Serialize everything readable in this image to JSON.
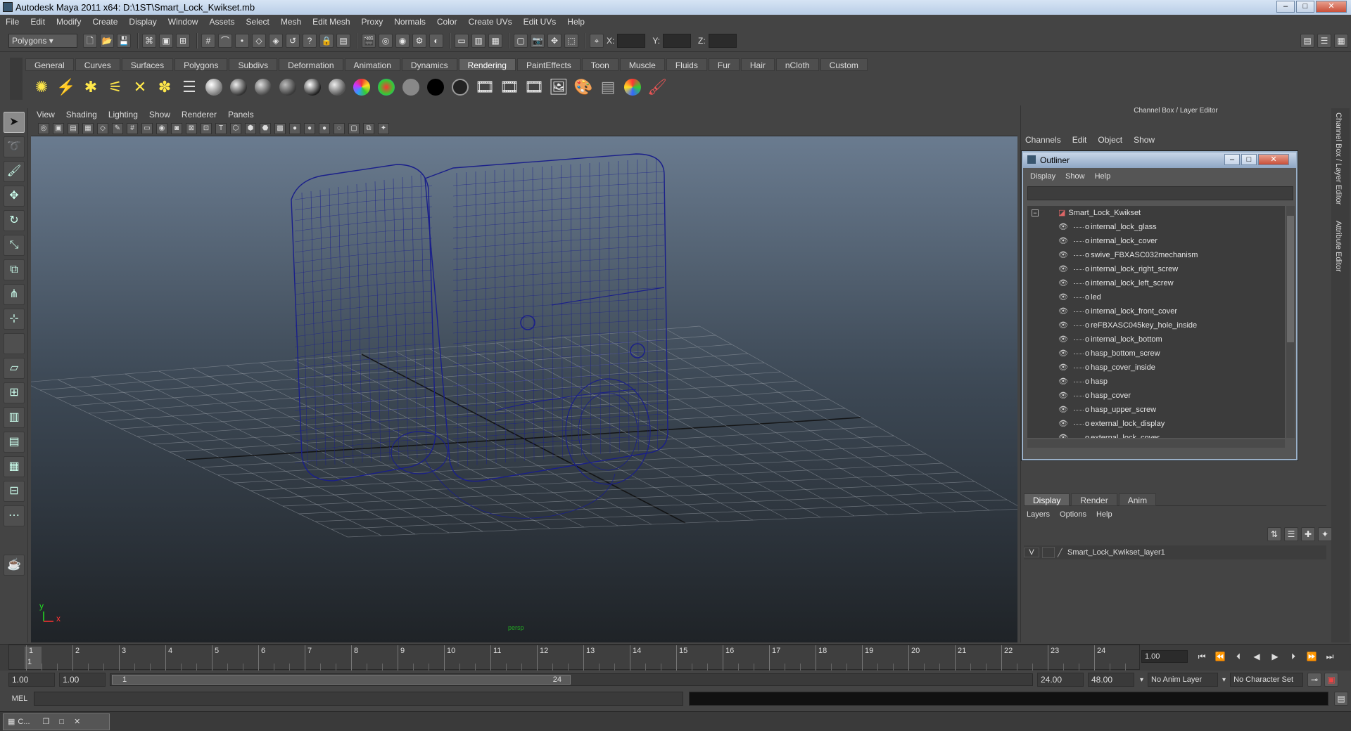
{
  "window": {
    "title": "Autodesk Maya 2011 x64: D:\\1ST\\Smart_Lock_Kwikset.mb",
    "minimize": "–",
    "maximize": "□",
    "close": "✕"
  },
  "menu": [
    "File",
    "Edit",
    "Modify",
    "Create",
    "Display",
    "Window",
    "Assets",
    "Select",
    "Mesh",
    "Edit Mesh",
    "Proxy",
    "Normals",
    "Color",
    "Create UVs",
    "Edit UVs",
    "Help"
  ],
  "status": {
    "mode": "Polygons",
    "x_label": "X:",
    "y_label": "Y:",
    "z_label": "Z:"
  },
  "shelf_tabs": [
    "General",
    "Curves",
    "Surfaces",
    "Polygons",
    "Subdivs",
    "Deformation",
    "Animation",
    "Dynamics",
    "Rendering",
    "PaintEffects",
    "Toon",
    "Muscle",
    "Fluids",
    "Fur",
    "Hair",
    "nCloth",
    "Custom"
  ],
  "active_shelf": "Rendering",
  "viewport": {
    "menu": [
      "View",
      "Shading",
      "Lighting",
      "Show",
      "Renderer",
      "Panels"
    ],
    "axis_x": "x",
    "axis_y": "y",
    "camera_label": "persp"
  },
  "colors": {
    "wire": "#1a1f8a",
    "grid": "#9aa0a8",
    "accent": "#6b86a8"
  },
  "channelbox": {
    "title": "Channel Box / Layer Editor",
    "menu": [
      "Channels",
      "Edit",
      "Object",
      "Show"
    ]
  },
  "outliner": {
    "title": "Outliner",
    "menu": [
      "Display",
      "Show",
      "Help"
    ],
    "root": "Smart_Lock_Kwikset",
    "items": [
      "internal_lock_glass",
      "internal_lock_cover",
      "swive_FBXASC032mechanism",
      "internal_lock_right_screw",
      "internal_lock_left_screw",
      "led",
      "internal_lock_front_cover",
      "reFBXASC045key_hole_inside",
      "internal_lock_bottom",
      "hasp_bottom_screw",
      "hasp_cover_inside",
      "hasp",
      "hasp_cover",
      "hasp_upper_screw",
      "external_lock_display",
      "external_lock_cover"
    ]
  },
  "layer_editor": {
    "tabs": [
      "Display",
      "Render",
      "Anim"
    ],
    "menu": [
      "Layers",
      "Options",
      "Help"
    ],
    "visible": "V",
    "layer": "Smart_Lock_Kwikset_layer1"
  },
  "side_tabs": {
    "channel": "Channel Box / Layer Editor",
    "attr": "Attribute Editor"
  },
  "timeline": {
    "ticks": [
      "1",
      "2",
      "3",
      "4",
      "5",
      "6",
      "7",
      "8",
      "9",
      "10",
      "11",
      "12",
      "13",
      "14",
      "15",
      "16",
      "17",
      "18",
      "19",
      "20",
      "21",
      "22",
      "23",
      "24"
    ],
    "current": "1.00",
    "frame_marker": "1"
  },
  "range": {
    "start": "1.00",
    "start2": "1.00",
    "slider_start": "1",
    "slider_end": "24",
    "end": "24.00",
    "end2": "48.00",
    "anim_layer": "No Anim Layer",
    "char_set": "No Character Set"
  },
  "cmdline": {
    "label": "MEL"
  },
  "taskbar": {
    "item": "C..."
  }
}
